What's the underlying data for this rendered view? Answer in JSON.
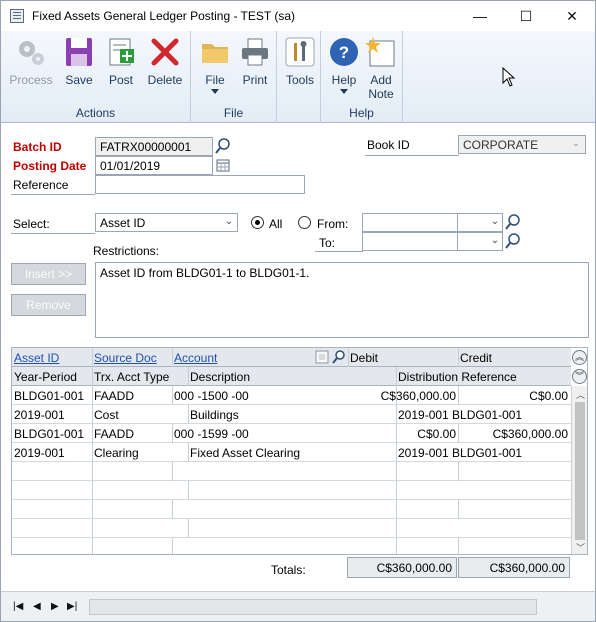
{
  "window": {
    "title": "Fixed Assets General Ledger Posting  -  TEST (sa)",
    "minimize": "—",
    "maximize": "☐",
    "close": "✕"
  },
  "ribbon": {
    "actions": {
      "label": "Actions",
      "process": "Process",
      "save": "Save",
      "post": "Post",
      "delete": "Delete"
    },
    "file": {
      "label": "File",
      "file": "File",
      "print": "Print"
    },
    "tools": {
      "tools": "Tools"
    },
    "help": {
      "label": "Help",
      "help": "Help",
      "add_note_line1": "Add",
      "add_note_line2": "Note"
    }
  },
  "form": {
    "batch_id_label": "Batch ID",
    "batch_id_value": "FATRX00000001",
    "posting_date_label": "Posting Date",
    "posting_date_value": "01/01/2019",
    "reference_label": "Reference",
    "reference_value": "",
    "book_id_label": "Book ID",
    "book_id_value": "CORPORATE",
    "select_label": "Select:",
    "select_value": "Asset ID",
    "all_label": "All",
    "from_label": "From:",
    "to_label": "To:",
    "restrictions_label": "Restrictions:",
    "restrictions_text": "Asset ID from BLDG01-1 to BLDG01-1.",
    "insert_label": "Insert >>",
    "remove_label": "Remove"
  },
  "grid": {
    "header1": {
      "asset_id": "Asset ID",
      "source_doc": "Source Doc",
      "account": "Account",
      "debit": "Debit",
      "credit": "Credit"
    },
    "header2": {
      "year_period": "Year-Period",
      "trx_acct_type": "Trx. Acct Type",
      "description": "Description",
      "distribution_reference": "Distribution Reference"
    },
    "rows": [
      {
        "c1": "BLDG01-001",
        "c2": "FAADD",
        "c3": "000 -1500 -00",
        "c4": "C$360,000.00",
        "c5": "C$0.00"
      },
      {
        "c1": "2019-001",
        "c2": "Cost",
        "c3": "Buildings",
        "c4": "2019-001 BLDG01-001",
        "c5": ""
      },
      {
        "c1": "BLDG01-001",
        "c2": "FAADD",
        "c3": "000 -1599 -00",
        "c4": "C$0.00",
        "c5": "C$360,000.00"
      },
      {
        "c1": "2019-001",
        "c2": "Clearing",
        "c3": "Fixed Asset Clearing",
        "c4": "2019-001 BLDG01-001",
        "c5": ""
      }
    ]
  },
  "totals": {
    "label": "Totals:",
    "debit": "C$360,000.00",
    "credit": "C$360,000.00"
  },
  "statusbar": {
    "first": "|◀",
    "prev": "◀",
    "next": "▶",
    "last": "▶|"
  }
}
